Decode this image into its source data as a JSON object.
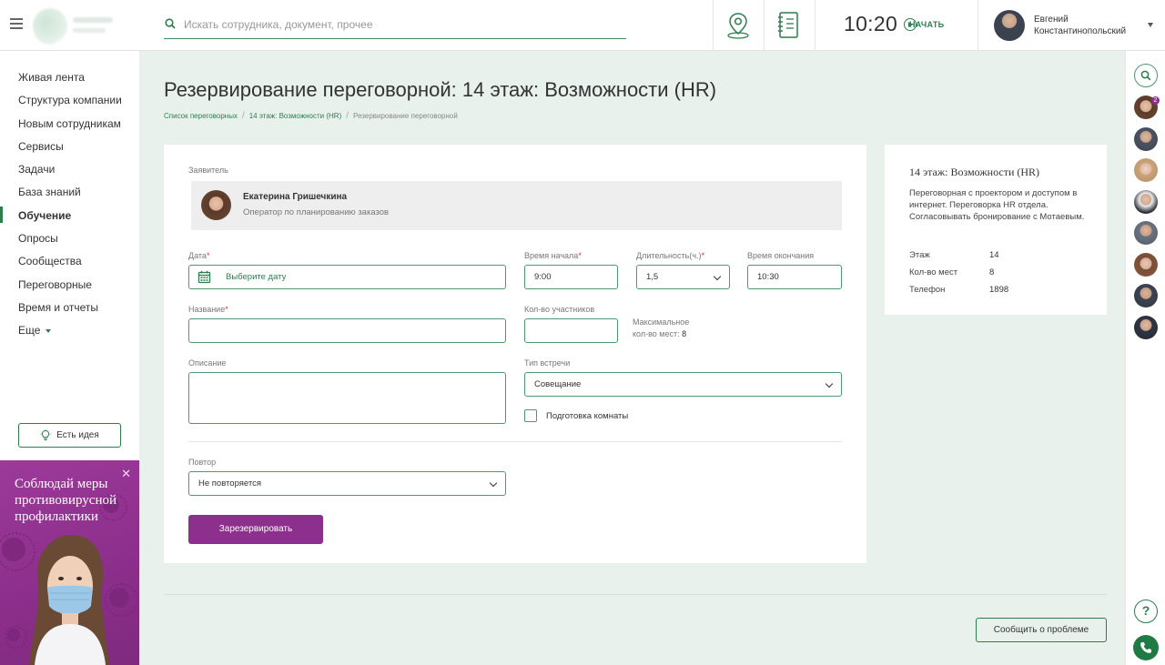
{
  "header": {
    "search_placeholder": "Искать сотрудника, документ, прочее",
    "time": "10:20",
    "start_label": "НАЧАТЬ",
    "user_first_name": "Евгений",
    "user_last_name": "Константинопольский"
  },
  "sidebar": {
    "items": [
      {
        "label": "Живая лента"
      },
      {
        "label": "Структура компании"
      },
      {
        "label": "Новым сотрудникам"
      },
      {
        "label": "Сервисы"
      },
      {
        "label": "Задачи"
      },
      {
        "label": "База знаний"
      },
      {
        "label": "Обучение",
        "active": true
      },
      {
        "label": "Опросы"
      },
      {
        "label": "Сообщества"
      },
      {
        "label": "Переговорные"
      },
      {
        "label": "Время и отчеты"
      },
      {
        "label": "Еще"
      }
    ],
    "idea_button": "Есть идея",
    "promo_text": "Соблюдай меры противовирусной профилактики"
  },
  "page": {
    "title": "Резервирование переговорной: 14 этаж: Возможности (HR)",
    "breadcrumb": [
      "Список переговорных",
      "14 этаж: Возможности (HR)",
      "Резервирование переговорной"
    ]
  },
  "form": {
    "applicant_label": "Заявитель",
    "applicant_name": "Екатерина Гришечкина",
    "applicant_role": "Оператор по планированию заказов",
    "date_label": "Дата",
    "date_placeholder": "Выберите дату",
    "start_time_label": "Время начала",
    "start_time_value": "9:00",
    "duration_label": "Длительность(ч.)",
    "duration_value": "1,5",
    "end_time_label": "Время окончания",
    "end_time_value": "10:30",
    "name_label": "Название",
    "participants_label": "Кол-во участников",
    "max_seats_label_line1": "Максимальное",
    "max_seats_label_line2": "кол-во мест:",
    "max_seats_value": "8",
    "description_label": "Описание",
    "meeting_type_label": "Тип встречи",
    "meeting_type_value": "Совещание",
    "room_prep_label": "Подготовка комнаты",
    "repeat_label": "Повтор",
    "repeat_value": "Не повторяется",
    "submit_label": "Зарезервировать",
    "required_mark": "*"
  },
  "room_info": {
    "title": "14 этаж: Возможности (HR)",
    "description": "Переговорная с проектором и доступом в интернет. Переговорка HR отдела. Согласовывать бронирование с Мотаевым.",
    "floor_label": "Этаж",
    "floor_value": "14",
    "seats_label": "Кол-во мест",
    "seats_value": "8",
    "phone_label": "Телефон",
    "phone_value": "1898"
  },
  "footer": {
    "report_button": "Сообщить о проблеме"
  },
  "rail": {
    "badge_count": "2",
    "help_symbol": "?"
  },
  "colors": {
    "accent_green": "#2e7d4f",
    "accent_purple": "#8d2f8c",
    "background": "#e9f1ec"
  }
}
